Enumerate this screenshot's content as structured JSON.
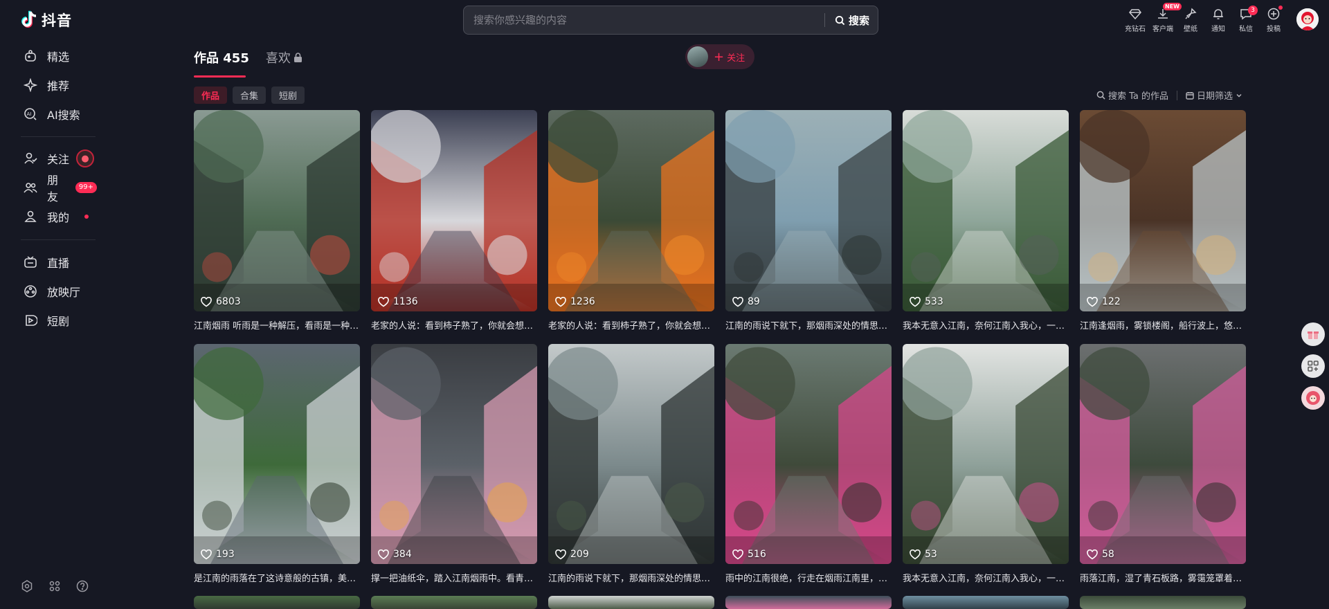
{
  "app": {
    "brand": "抖音"
  },
  "sidebar": {
    "items": [
      {
        "label": "精选",
        "icon": "featured-icon"
      },
      {
        "label": "推荐",
        "icon": "sparkle-icon"
      },
      {
        "label": "AI搜索",
        "icon": "ai-search-icon"
      },
      {
        "label": "关注",
        "icon": "follow-icon",
        "badge": "avatar"
      },
      {
        "label": "朋友",
        "icon": "friends-icon",
        "badge": "99+"
      },
      {
        "label": "我的",
        "icon": "me-icon",
        "badge": "dot"
      },
      {
        "label": "直播",
        "icon": "live-icon"
      },
      {
        "label": "放映厅",
        "icon": "theater-icon"
      },
      {
        "label": "短剧",
        "icon": "short-drama-icon"
      }
    ],
    "friends_badge": "99+"
  },
  "search": {
    "placeholder": "搜索你感兴趣的内容",
    "button": "搜索"
  },
  "top_actions": [
    {
      "label": "充钻石",
      "icon": "diamond-icon"
    },
    {
      "label": "客户端",
      "icon": "download-icon",
      "tag": "NEW"
    },
    {
      "label": "壁纸",
      "icon": "wallpaper-icon"
    },
    {
      "label": "通知",
      "icon": "bell-icon"
    },
    {
      "label": "私信",
      "icon": "message-icon",
      "tag": "3"
    },
    {
      "label": "投稿",
      "icon": "upload-icon",
      "tag": "dot"
    }
  ],
  "profile": {
    "tab_works": "作品 455",
    "tab_likes": "喜欢",
    "follow_label": "关注",
    "chips": [
      "作品",
      "合集",
      "短剧"
    ],
    "search_works": "搜索 Ta 的作品",
    "date_filter": "日期筛选"
  },
  "videos": [
    {
      "likes": "6803",
      "caption": "江南烟雨 听雨是一种解压，看雨是一种享受",
      "palette": [
        "#4f6b54",
        "#2e3b33",
        "#8a9a93",
        "#c24a3e"
      ]
    },
    {
      "likes": "1136",
      "caption": "老家的人说：看到柿子熟了，你就会想家了",
      "palette": [
        "#d7d7db",
        "#b43024",
        "#3b3f52",
        "#e0e2e6"
      ]
    },
    {
      "likes": "1236",
      "caption": "老家的人说：看到柿子熟了，你就会想家了",
      "palette": [
        "#3b4a36",
        "#e8711f",
        "#5d6a60",
        "#f08a2a"
      ]
    },
    {
      "likes": "89",
      "caption": "江南的雨说下就下，那烟雨深处的情思悠悠",
      "palette": [
        "#7f9eaf",
        "#3b4447",
        "#9cb0b6",
        "#2c3433"
      ]
    },
    {
      "likes": "533",
      "caption": "我本无意入江南，奈何江南入我心，一帘烟雨",
      "palette": [
        "#8fa69a",
        "#3a5a37",
        "#d8dcd8",
        "#56605a"
      ]
    },
    {
      "likes": "122",
      "caption": "江南逢烟雨，雾锁楼阁，船行波上，悠然入画",
      "palette": [
        "#4a3326",
        "#b8c2c4",
        "#6b4b34",
        "#d7b27a"
      ]
    },
    {
      "likes": "193",
      "caption": "是江南的雨落在了这诗意般的古镇，美不胜收",
      "palette": [
        "#3e6a3a",
        "#c9cfd1",
        "#5c6670",
        "#2d3a2b"
      ]
    },
    {
      "likes": "384",
      "caption": "撑一把油纸伞，踏入江南烟雨中。看青石板路",
      "palette": [
        "#5b6168",
        "#d59ab0",
        "#3a3d42",
        "#e9a64a"
      ]
    },
    {
      "likes": "209",
      "caption": "江南的雨说下就下，那烟雨深处的情思悠悠",
      "palette": [
        "#7c8a8c",
        "#2f3635",
        "#c3c9ca",
        "#4a5a48"
      ]
    },
    {
      "likes": "516",
      "caption": "雨中的江南很绝，行走在烟雨江南里，感受诗意",
      "palette": [
        "#3f4a3a",
        "#d6478a",
        "#6b7a72",
        "#2c3029"
      ]
    },
    {
      "likes": "53",
      "caption": "我本无意入江南，奈何江南入我心，一帘烟雨",
      "palette": [
        "#8fa19a",
        "#394a35",
        "#e2e4e2",
        "#c8508a"
      ]
    },
    {
      "likes": "58",
      "caption": "雨落江南，湿了青石板路，雾霭笼罩着古镇",
      "palette": [
        "#3d4a3c",
        "#d05c9a",
        "#6c6f70",
        "#2b302a"
      ]
    }
  ],
  "partial_row_palettes": [
    [
      "#496a44",
      "#2f3a30"
    ],
    [
      "#5b7c54",
      "#394535"
    ],
    [
      "#cfd4d2",
      "#4c5b48"
    ],
    [
      "#3e4e5a",
      "#d06b9a"
    ],
    [
      "#6e8ea0",
      "#30414a"
    ],
    [
      "#3b4b3a",
      "#6a7d66"
    ]
  ],
  "floaters": [
    "gift-icon",
    "apps-icon",
    "avatar-icon"
  ]
}
